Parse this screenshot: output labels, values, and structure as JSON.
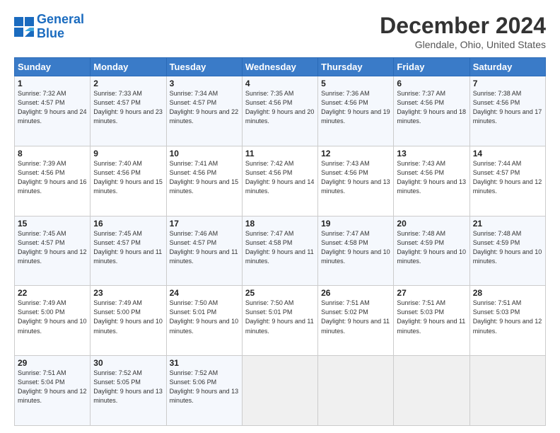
{
  "logo": {
    "text1": "General",
    "text2": "Blue"
  },
  "header": {
    "month": "December 2024",
    "location": "Glendale, Ohio, United States"
  },
  "days_of_week": [
    "Sunday",
    "Monday",
    "Tuesday",
    "Wednesday",
    "Thursday",
    "Friday",
    "Saturday"
  ],
  "weeks": [
    [
      {
        "day": "1",
        "sunrise": "Sunrise: 7:32 AM",
        "sunset": "Sunset: 4:57 PM",
        "daylight": "Daylight: 9 hours and 24 minutes."
      },
      {
        "day": "2",
        "sunrise": "Sunrise: 7:33 AM",
        "sunset": "Sunset: 4:57 PM",
        "daylight": "Daylight: 9 hours and 23 minutes."
      },
      {
        "day": "3",
        "sunrise": "Sunrise: 7:34 AM",
        "sunset": "Sunset: 4:57 PM",
        "daylight": "Daylight: 9 hours and 22 minutes."
      },
      {
        "day": "4",
        "sunrise": "Sunrise: 7:35 AM",
        "sunset": "Sunset: 4:56 PM",
        "daylight": "Daylight: 9 hours and 20 minutes."
      },
      {
        "day": "5",
        "sunrise": "Sunrise: 7:36 AM",
        "sunset": "Sunset: 4:56 PM",
        "daylight": "Daylight: 9 hours and 19 minutes."
      },
      {
        "day": "6",
        "sunrise": "Sunrise: 7:37 AM",
        "sunset": "Sunset: 4:56 PM",
        "daylight": "Daylight: 9 hours and 18 minutes."
      },
      {
        "day": "7",
        "sunrise": "Sunrise: 7:38 AM",
        "sunset": "Sunset: 4:56 PM",
        "daylight": "Daylight: 9 hours and 17 minutes."
      }
    ],
    [
      {
        "day": "8",
        "sunrise": "Sunrise: 7:39 AM",
        "sunset": "Sunset: 4:56 PM",
        "daylight": "Daylight: 9 hours and 16 minutes."
      },
      {
        "day": "9",
        "sunrise": "Sunrise: 7:40 AM",
        "sunset": "Sunset: 4:56 PM",
        "daylight": "Daylight: 9 hours and 15 minutes."
      },
      {
        "day": "10",
        "sunrise": "Sunrise: 7:41 AM",
        "sunset": "Sunset: 4:56 PM",
        "daylight": "Daylight: 9 hours and 15 minutes."
      },
      {
        "day": "11",
        "sunrise": "Sunrise: 7:42 AM",
        "sunset": "Sunset: 4:56 PM",
        "daylight": "Daylight: 9 hours and 14 minutes."
      },
      {
        "day": "12",
        "sunrise": "Sunrise: 7:43 AM",
        "sunset": "Sunset: 4:56 PM",
        "daylight": "Daylight: 9 hours and 13 minutes."
      },
      {
        "day": "13",
        "sunrise": "Sunrise: 7:43 AM",
        "sunset": "Sunset: 4:56 PM",
        "daylight": "Daylight: 9 hours and 13 minutes."
      },
      {
        "day": "14",
        "sunrise": "Sunrise: 7:44 AM",
        "sunset": "Sunset: 4:57 PM",
        "daylight": "Daylight: 9 hours and 12 minutes."
      }
    ],
    [
      {
        "day": "15",
        "sunrise": "Sunrise: 7:45 AM",
        "sunset": "Sunset: 4:57 PM",
        "daylight": "Daylight: 9 hours and 12 minutes."
      },
      {
        "day": "16",
        "sunrise": "Sunrise: 7:45 AM",
        "sunset": "Sunset: 4:57 PM",
        "daylight": "Daylight: 9 hours and 11 minutes."
      },
      {
        "day": "17",
        "sunrise": "Sunrise: 7:46 AM",
        "sunset": "Sunset: 4:57 PM",
        "daylight": "Daylight: 9 hours and 11 minutes."
      },
      {
        "day": "18",
        "sunrise": "Sunrise: 7:47 AM",
        "sunset": "Sunset: 4:58 PM",
        "daylight": "Daylight: 9 hours and 11 minutes."
      },
      {
        "day": "19",
        "sunrise": "Sunrise: 7:47 AM",
        "sunset": "Sunset: 4:58 PM",
        "daylight": "Daylight: 9 hours and 10 minutes."
      },
      {
        "day": "20",
        "sunrise": "Sunrise: 7:48 AM",
        "sunset": "Sunset: 4:59 PM",
        "daylight": "Daylight: 9 hours and 10 minutes."
      },
      {
        "day": "21",
        "sunrise": "Sunrise: 7:48 AM",
        "sunset": "Sunset: 4:59 PM",
        "daylight": "Daylight: 9 hours and 10 minutes."
      }
    ],
    [
      {
        "day": "22",
        "sunrise": "Sunrise: 7:49 AM",
        "sunset": "Sunset: 5:00 PM",
        "daylight": "Daylight: 9 hours and 10 minutes."
      },
      {
        "day": "23",
        "sunrise": "Sunrise: 7:49 AM",
        "sunset": "Sunset: 5:00 PM",
        "daylight": "Daylight: 9 hours and 10 minutes."
      },
      {
        "day": "24",
        "sunrise": "Sunrise: 7:50 AM",
        "sunset": "Sunset: 5:01 PM",
        "daylight": "Daylight: 9 hours and 10 minutes."
      },
      {
        "day": "25",
        "sunrise": "Sunrise: 7:50 AM",
        "sunset": "Sunset: 5:01 PM",
        "daylight": "Daylight: 9 hours and 11 minutes."
      },
      {
        "day": "26",
        "sunrise": "Sunrise: 7:51 AM",
        "sunset": "Sunset: 5:02 PM",
        "daylight": "Daylight: 9 hours and 11 minutes."
      },
      {
        "day": "27",
        "sunrise": "Sunrise: 7:51 AM",
        "sunset": "Sunset: 5:03 PM",
        "daylight": "Daylight: 9 hours and 11 minutes."
      },
      {
        "day": "28",
        "sunrise": "Sunrise: 7:51 AM",
        "sunset": "Sunset: 5:03 PM",
        "daylight": "Daylight: 9 hours and 12 minutes."
      }
    ],
    [
      {
        "day": "29",
        "sunrise": "Sunrise: 7:51 AM",
        "sunset": "Sunset: 5:04 PM",
        "daylight": "Daylight: 9 hours and 12 minutes."
      },
      {
        "day": "30",
        "sunrise": "Sunrise: 7:52 AM",
        "sunset": "Sunset: 5:05 PM",
        "daylight": "Daylight: 9 hours and 13 minutes."
      },
      {
        "day": "31",
        "sunrise": "Sunrise: 7:52 AM",
        "sunset": "Sunset: 5:06 PM",
        "daylight": "Daylight: 9 hours and 13 minutes."
      },
      null,
      null,
      null,
      null
    ]
  ]
}
